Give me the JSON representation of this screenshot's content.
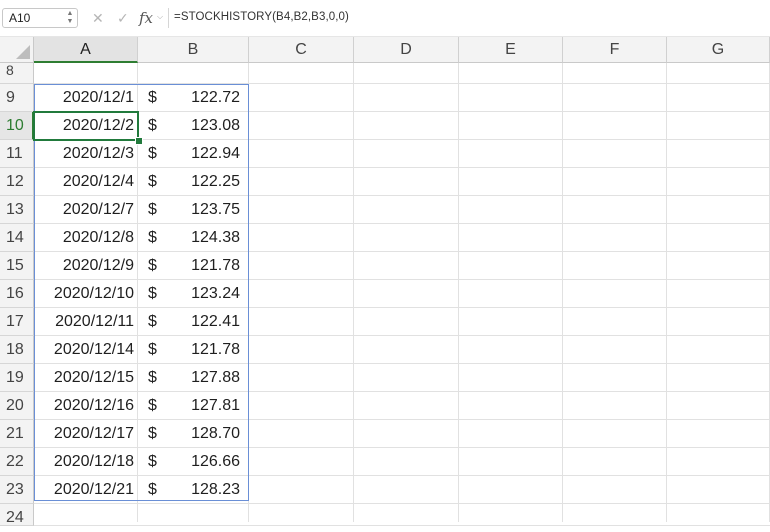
{
  "name_box": "A10",
  "formula": "=STOCKHISTORY(B4,B2,B3,0,0)",
  "fx_label": "fx",
  "columns": [
    "A",
    "B",
    "C",
    "D",
    "E",
    "F",
    "G"
  ],
  "rows": [
    {
      "num": "8",
      "date": "",
      "currency": "",
      "price": ""
    },
    {
      "num": "9",
      "date": "2020/12/1",
      "currency": "$",
      "price": "122.72"
    },
    {
      "num": "10",
      "date": "2020/12/2",
      "currency": "$",
      "price": "123.08"
    },
    {
      "num": "11",
      "date": "2020/12/3",
      "currency": "$",
      "price": "122.94"
    },
    {
      "num": "12",
      "date": "2020/12/4",
      "currency": "$",
      "price": "122.25"
    },
    {
      "num": "13",
      "date": "2020/12/7",
      "currency": "$",
      "price": "123.75"
    },
    {
      "num": "14",
      "date": "2020/12/8",
      "currency": "$",
      "price": "124.38"
    },
    {
      "num": "15",
      "date": "2020/12/9",
      "currency": "$",
      "price": "121.78"
    },
    {
      "num": "16",
      "date": "2020/12/10",
      "currency": "$",
      "price": "123.24"
    },
    {
      "num": "17",
      "date": "2020/12/11",
      "currency": "$",
      "price": "122.41"
    },
    {
      "num": "18",
      "date": "2020/12/14",
      "currency": "$",
      "price": "121.78"
    },
    {
      "num": "19",
      "date": "2020/12/15",
      "currency": "$",
      "price": "127.88"
    },
    {
      "num": "20",
      "date": "2020/12/16",
      "currency": "$",
      "price": "127.81"
    },
    {
      "num": "21",
      "date": "2020/12/17",
      "currency": "$",
      "price": "128.70"
    },
    {
      "num": "22",
      "date": "2020/12/18",
      "currency": "$",
      "price": "126.66"
    },
    {
      "num": "23",
      "date": "2020/12/21",
      "currency": "$",
      "price": "128.23"
    },
    {
      "num": "24",
      "date": "",
      "currency": "",
      "price": ""
    }
  ],
  "selected_row": "10",
  "selected_column": "A",
  "colors": {
    "selection": "#217a3c",
    "range_border": "#6a8fd6"
  }
}
